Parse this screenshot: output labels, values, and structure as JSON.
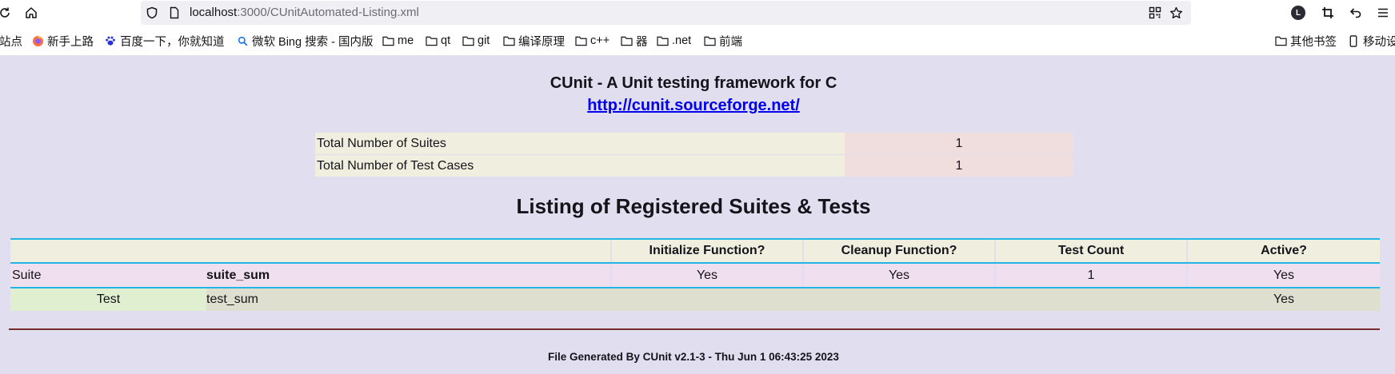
{
  "browser": {
    "url_host": "localhost",
    "url_path": ":3000/CUnitAutomated-Listing.xml",
    "avatar_letter": "L",
    "bookmarks": [
      {
        "label": "站点",
        "icon": "none"
      },
      {
        "label": "新手上路",
        "icon": "firefox-icon"
      },
      {
        "label": "百度一下，你就知道",
        "icon": "baidu-paw-icon"
      },
      {
        "label": "微软 Bing 搜索 - 国内版",
        "icon": "search-icon"
      },
      {
        "label": "me",
        "icon": "folder-icon"
      },
      {
        "label": "qt",
        "icon": "folder-icon"
      },
      {
        "label": "git",
        "icon": "folder-icon"
      },
      {
        "label": "编译原理",
        "icon": "folder-icon"
      },
      {
        "label": "c++",
        "icon": "folder-icon"
      },
      {
        "label": "器",
        "icon": "folder-icon"
      },
      {
        "label": ".net",
        "icon": "folder-icon"
      },
      {
        "label": "前端",
        "icon": "folder-icon"
      },
      {
        "label": "其他书签",
        "icon": "folder-icon"
      },
      {
        "label": "移动设",
        "icon": "mobile-icon"
      }
    ]
  },
  "header": {
    "title": "CUnit - A Unit testing framework for C",
    "link": "http://cunit.sourceforge.net/"
  },
  "summary": [
    {
      "label": "Total Number of Suites",
      "value": "1"
    },
    {
      "label": "Total Number of Test Cases",
      "value": "1"
    }
  ],
  "listing": {
    "title": "Listing of Registered Suites & Tests",
    "columns": [
      "",
      "",
      "Initialize Function?",
      "Cleanup Function?",
      "Test Count",
      "Active?"
    ],
    "suite": {
      "type": "Suite",
      "name": "suite_sum",
      "init": "Yes",
      "cleanup": "Yes",
      "count": "1",
      "active": "Yes"
    },
    "test": {
      "type": "Test",
      "name": "test_sum",
      "active": "Yes"
    }
  },
  "footer": "File Generated By CUnit v2.1-3 - Thu Jun 1 06:43:25 2023",
  "colors": {
    "page_bg": "#e0deef",
    "summary_label_bg": "#f0eedf",
    "summary_value_bg": "#f0dedf",
    "header_border": "#22b5e8",
    "suite_row_bg": "#efdfef",
    "test_row_bg": "#dfdfcf",
    "test_type_bg": "#dfefcf",
    "rule": "#7a2a2a",
    "link": "#0000ee"
  }
}
